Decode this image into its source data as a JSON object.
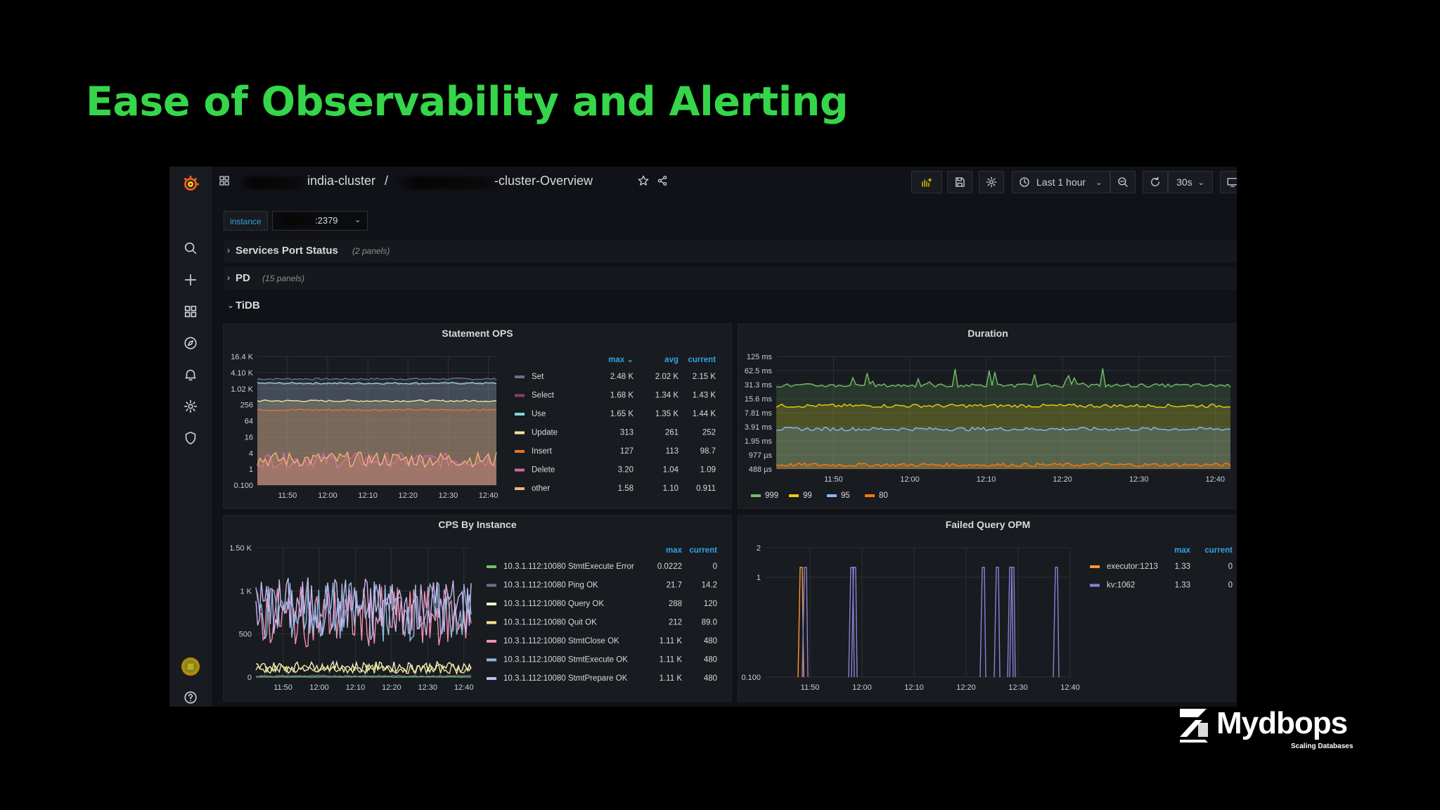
{
  "slide": {
    "title": "Ease of Observability and Alerting"
  },
  "topbar": {
    "crumb_cluster": "india-cluster",
    "crumb_sep": "/",
    "crumb_dashboard": "-cluster-Overview",
    "time_range": "Last 1 hour",
    "refresh": "30s"
  },
  "variables": {
    "label": "instance",
    "value": ":2379"
  },
  "rows": [
    {
      "title": "Services Port Status",
      "count": "(2 panels)",
      "collapsed": true
    },
    {
      "title": "PD",
      "count": "(15 panels)",
      "collapsed": true
    },
    {
      "title": "TiDB",
      "count": "",
      "collapsed": false
    }
  ],
  "colors": {
    "accent_blue": "#33a2e5",
    "title_green": "#35d64a",
    "panel_bg": "#181b1f",
    "page_bg": "#111217"
  },
  "chart_data": [
    {
      "panel": "statement_ops",
      "type": "line",
      "title": "Statement OPS",
      "y_scale": "log2",
      "y_ticks": [
        "16.4 K",
        "4.10 K",
        "1.02 K",
        "256",
        "64",
        "16",
        "4",
        "1",
        "0.100"
      ],
      "x_ticks": [
        "11:50",
        "12:00",
        "12:10",
        "12:20",
        "12:30",
        "12:40"
      ],
      "legend_columns": [
        "max",
        "avg",
        "current"
      ],
      "legend_sort": "max",
      "series": [
        {
          "name": "Set",
          "color": "#6f6e8f",
          "max": "2.48 K",
          "avg": "2.02 K",
          "current": "2.15 K",
          "level": 2020
        },
        {
          "name": "Select",
          "color": "#8a3c6b",
          "max": "1.68 K",
          "avg": "1.34 K",
          "current": "1.43 K",
          "level": 1340
        },
        {
          "name": "Use",
          "color": "#7fd6d8",
          "max": "1.65 K",
          "avg": "1.35 K",
          "current": "1.44 K",
          "level": 1350
        },
        {
          "name": "Update",
          "color": "#f2e59a",
          "max": "313",
          "avg": "261",
          "current": "252",
          "level": 261
        },
        {
          "name": "Insert",
          "color": "#e0752d",
          "max": "127",
          "avg": "113",
          "current": "98.7",
          "level": 113
        },
        {
          "name": "Delete",
          "color": "#d06aa0",
          "max": "3.20",
          "avg": "1.04",
          "current": "1.09",
          "level": 1.04
        },
        {
          "name": "other",
          "color": "#f7b17a",
          "max": "1.58",
          "avg": "1.10",
          "current": "0.911",
          "level": 1.1
        }
      ]
    },
    {
      "panel": "duration",
      "type": "line",
      "title": "Duration",
      "y_scale": "log2",
      "y_ticks": [
        "125 ms",
        "62.5 ms",
        "31.3 ms",
        "15.6 ms",
        "7.81 ms",
        "3.91 ms",
        "1.95 ms",
        "977 µs",
        "488 µs"
      ],
      "x_ticks": [
        "11:50",
        "12:00",
        "12:10",
        "12:20",
        "12:30",
        "12:40"
      ],
      "series": [
        {
          "name": "999",
          "color": "#73bf69",
          "level_ms": 30
        },
        {
          "name": "99",
          "color": "#f2cc0c",
          "level_ms": 11
        },
        {
          "name": "95",
          "color": "#8ab8ff",
          "level_ms": 3.5
        },
        {
          "name": "80",
          "color": "#ff780a",
          "level_ms": 0.6
        }
      ]
    },
    {
      "panel": "cps_by_instance",
      "type": "line",
      "title": "CPS By Instance",
      "y_ticks": [
        "1.50 K",
        "1 K",
        "500",
        "0"
      ],
      "ylim": [
        0,
        1500
      ],
      "x_ticks": [
        "11:50",
        "12:00",
        "12:10",
        "12:20",
        "12:30",
        "12:40"
      ],
      "legend_columns": [
        "max",
        "current"
      ],
      "series": [
        {
          "name": "10.3.1.112:10080 StmtExecute Error",
          "color": "#73bf69",
          "max": "0.0222",
          "current": "0"
        },
        {
          "name": "10.3.1.112:10080 Ping OK",
          "color": "#6f6e8f",
          "max": "21.7",
          "current": "14.2"
        },
        {
          "name": "10.3.1.112:10080 Query OK",
          "color": "#f2f2c0",
          "max": "288",
          "current": "120"
        },
        {
          "name": "10.3.1.112:10080 Quit OK",
          "color": "#f2e59a",
          "max": "212",
          "current": "89.0"
        },
        {
          "name": "10.3.1.112:10080 StmtClose OK",
          "color": "#f48fb1",
          "max": "1.11 K",
          "current": "480"
        },
        {
          "name": "10.3.1.112:10080 StmtExecute OK",
          "color": "#8fb8e0",
          "max": "1.11 K",
          "current": "480"
        },
        {
          "name": "10.3.1.112:10080 StmtPrepare OK",
          "color": "#c9b8f0",
          "max": "1.11 K",
          "current": "480"
        }
      ]
    },
    {
      "panel": "failed_query_opm",
      "type": "line",
      "title": "Failed Query OPM",
      "y_ticks": [
        "2",
        "1",
        "0.100"
      ],
      "x_ticks": [
        "11:50",
        "12:00",
        "12:10",
        "12:20",
        "12:30",
        "12:40"
      ],
      "legend_columns": [
        "max",
        "current"
      ],
      "series": [
        {
          "name": "executor:1213",
          "color": "#ff9830",
          "max": "1.33",
          "current": "0"
        },
        {
          "name": "kv:1062",
          "color": "#8f7fd6",
          "max": "1.33",
          "current": "0"
        }
      ]
    }
  ],
  "brand": {
    "name": "Mydbops",
    "tagline": "Scaling Databases"
  }
}
